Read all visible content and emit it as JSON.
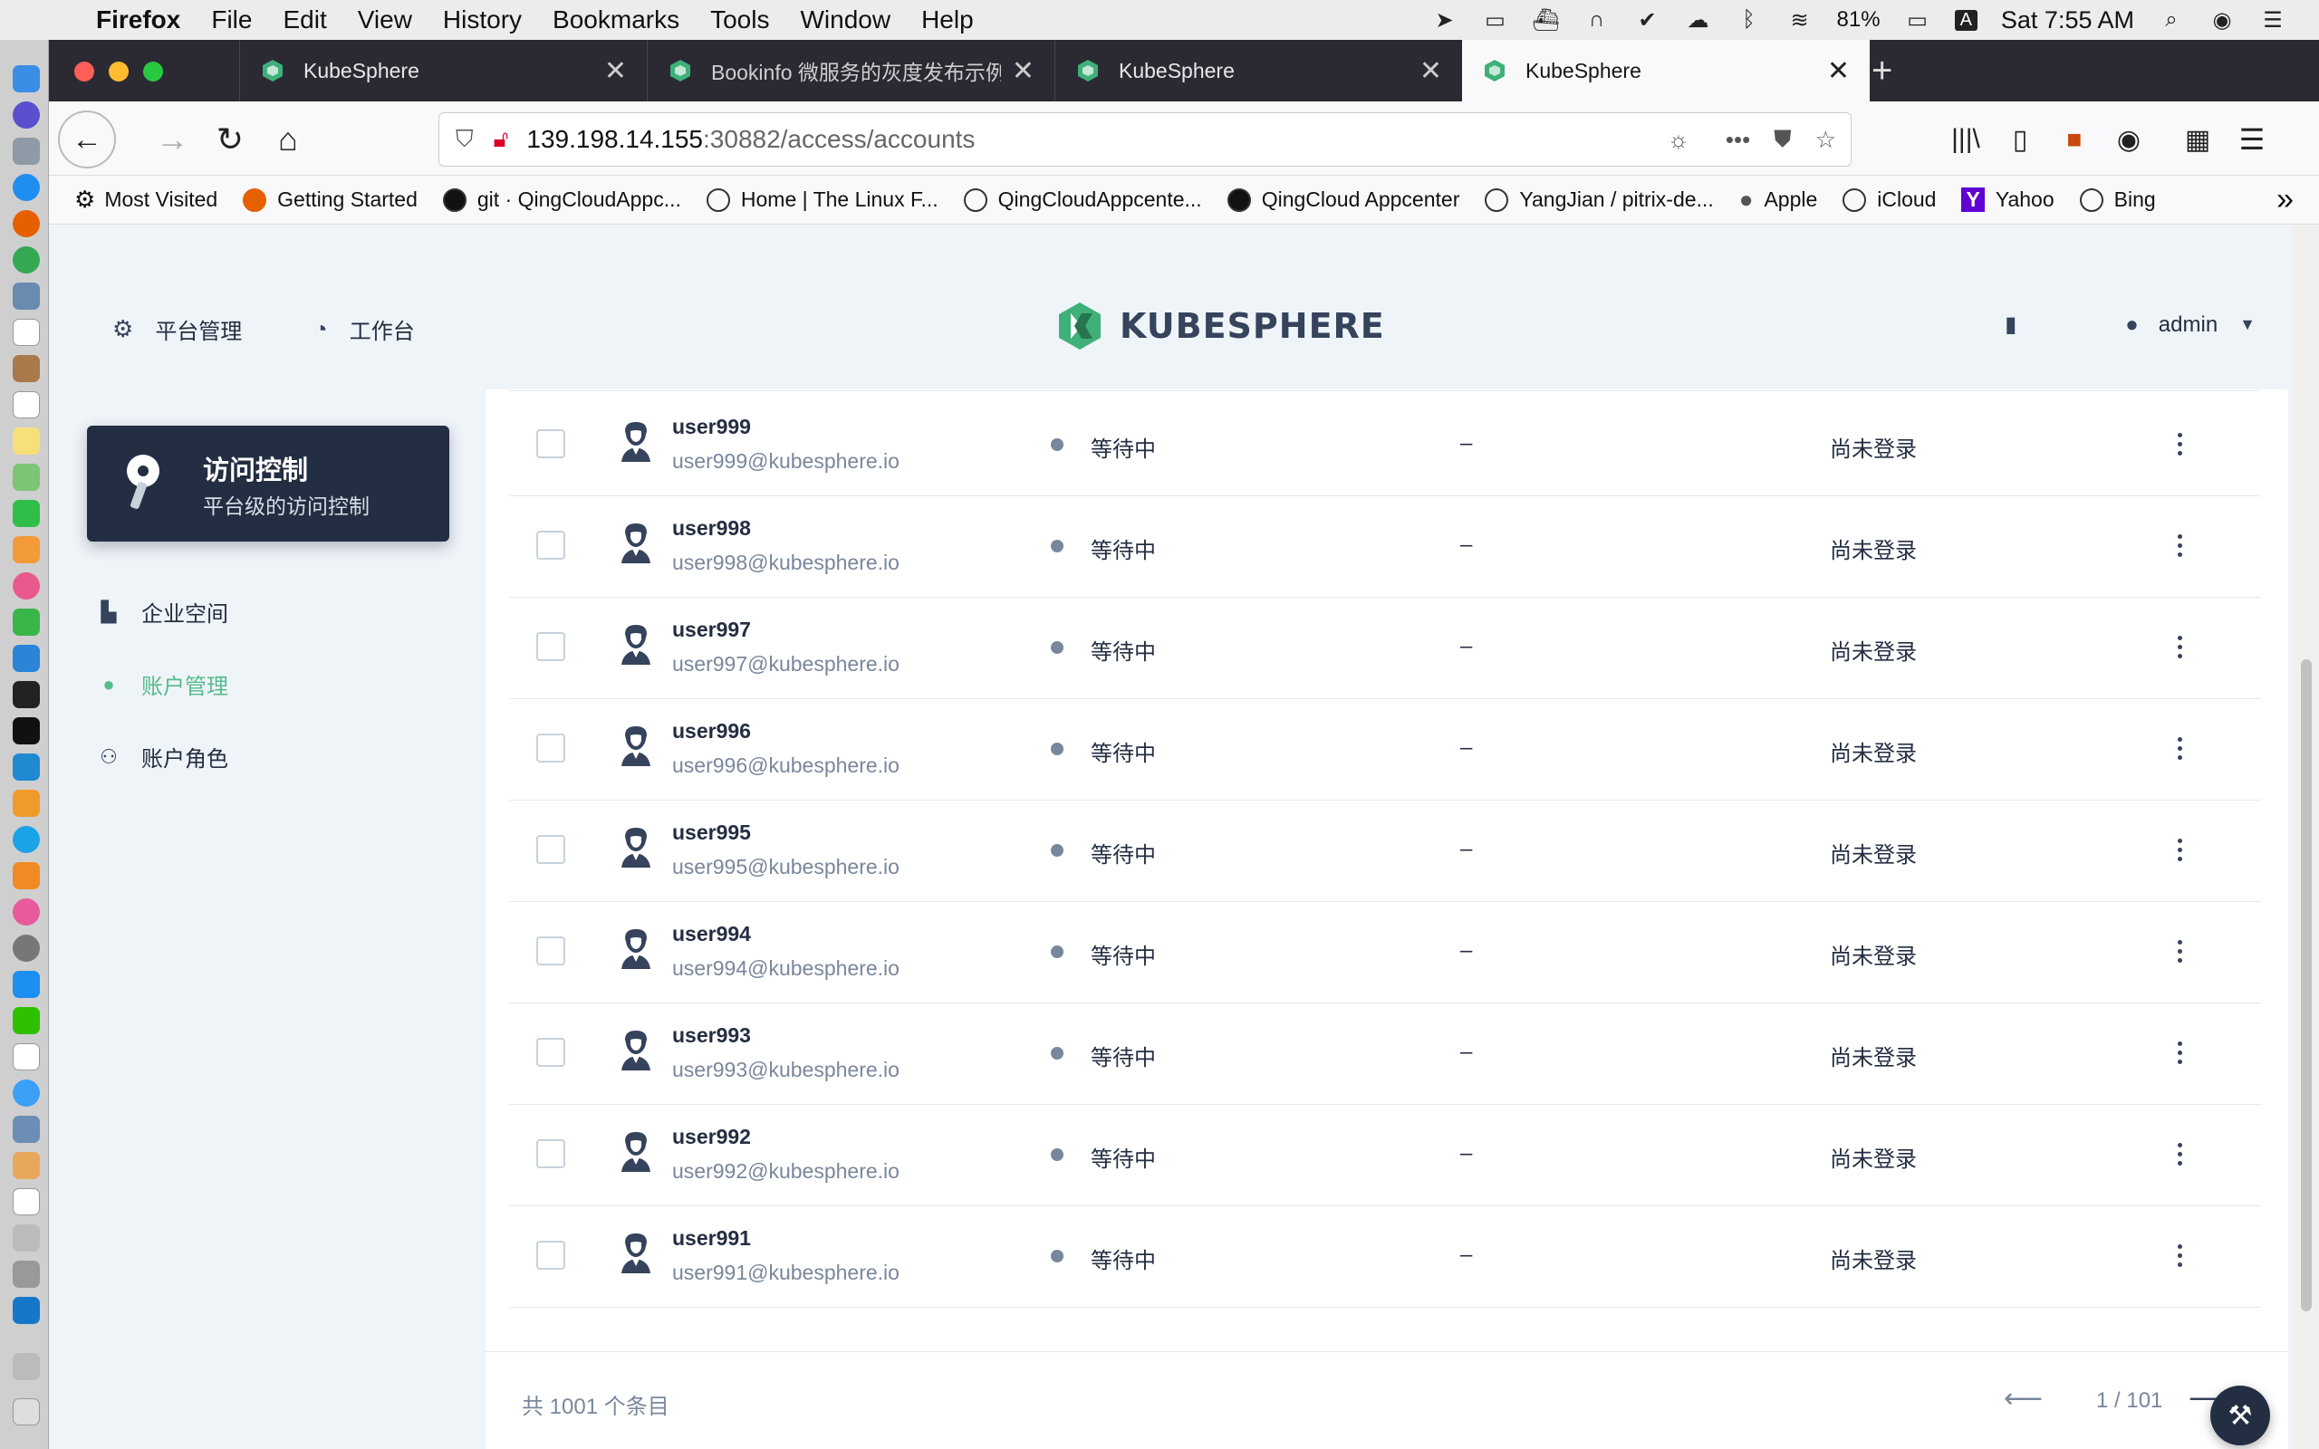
{
  "menubar": {
    "app_name": "Firefox",
    "menus": [
      "File",
      "Edit",
      "View",
      "History",
      "Bookmarks",
      "Tools",
      "Window",
      "Help"
    ],
    "battery": "81%",
    "input_source": "A",
    "clock": "Sat 7:55 AM"
  },
  "browser": {
    "tabs": [
      {
        "title": "KubeSphere",
        "active": false
      },
      {
        "title": "Bookinfo 微服务的灰度发布示例 |",
        "active": false
      },
      {
        "title": "KubeSphere",
        "active": false
      },
      {
        "title": "KubeSphere",
        "active": true
      }
    ],
    "url_host": "139.198.14.155",
    "url_rest": ":30882/access/accounts",
    "bookmarks": [
      "Most Visited",
      "Getting Started",
      "git · QingCloudAppc...",
      "Home | The Linux F...",
      "QingCloudAppcente...",
      "QingCloud Appcenter",
      "YangJian / pitrix-de...",
      "Apple",
      "iCloud",
      "Yahoo",
      "Bing"
    ]
  },
  "header": {
    "platform_label": "平台管理",
    "workbench_label": "工作台",
    "logo_text": "KUBESPHERE",
    "user": "admin"
  },
  "sidebar": {
    "card_title": "访问控制",
    "card_subtitle": "平台级的访问控制",
    "items": [
      {
        "label": "企业空间",
        "active": false
      },
      {
        "label": "账户管理",
        "active": true
      },
      {
        "label": "账户角色",
        "active": false
      }
    ]
  },
  "table": {
    "rows": [
      {
        "username": "user999",
        "email": "user999@kubesphere.io",
        "status": "等待中",
        "role": "–",
        "last_login": "尚未登录"
      },
      {
        "username": "user998",
        "email": "user998@kubesphere.io",
        "status": "等待中",
        "role": "–",
        "last_login": "尚未登录"
      },
      {
        "username": "user997",
        "email": "user997@kubesphere.io",
        "status": "等待中",
        "role": "–",
        "last_login": "尚未登录"
      },
      {
        "username": "user996",
        "email": "user996@kubesphere.io",
        "status": "等待中",
        "role": "–",
        "last_login": "尚未登录"
      },
      {
        "username": "user995",
        "email": "user995@kubesphere.io",
        "status": "等待中",
        "role": "–",
        "last_login": "尚未登录"
      },
      {
        "username": "user994",
        "email": "user994@kubesphere.io",
        "status": "等待中",
        "role": "–",
        "last_login": "尚未登录"
      },
      {
        "username": "user993",
        "email": "user993@kubesphere.io",
        "status": "等待中",
        "role": "–",
        "last_login": "尚未登录"
      },
      {
        "username": "user992",
        "email": "user992@kubesphere.io",
        "status": "等待中",
        "role": "–",
        "last_login": "尚未登录"
      },
      {
        "username": "user991",
        "email": "user991@kubesphere.io",
        "status": "等待中",
        "role": "–",
        "last_login": "尚未登录"
      }
    ]
  },
  "footer": {
    "total": "共 1001 个条目",
    "pagination": "1 / 101"
  },
  "colors": {
    "accent": "#55bc8a",
    "dark": "#242e42",
    "muted": "#79879c"
  }
}
